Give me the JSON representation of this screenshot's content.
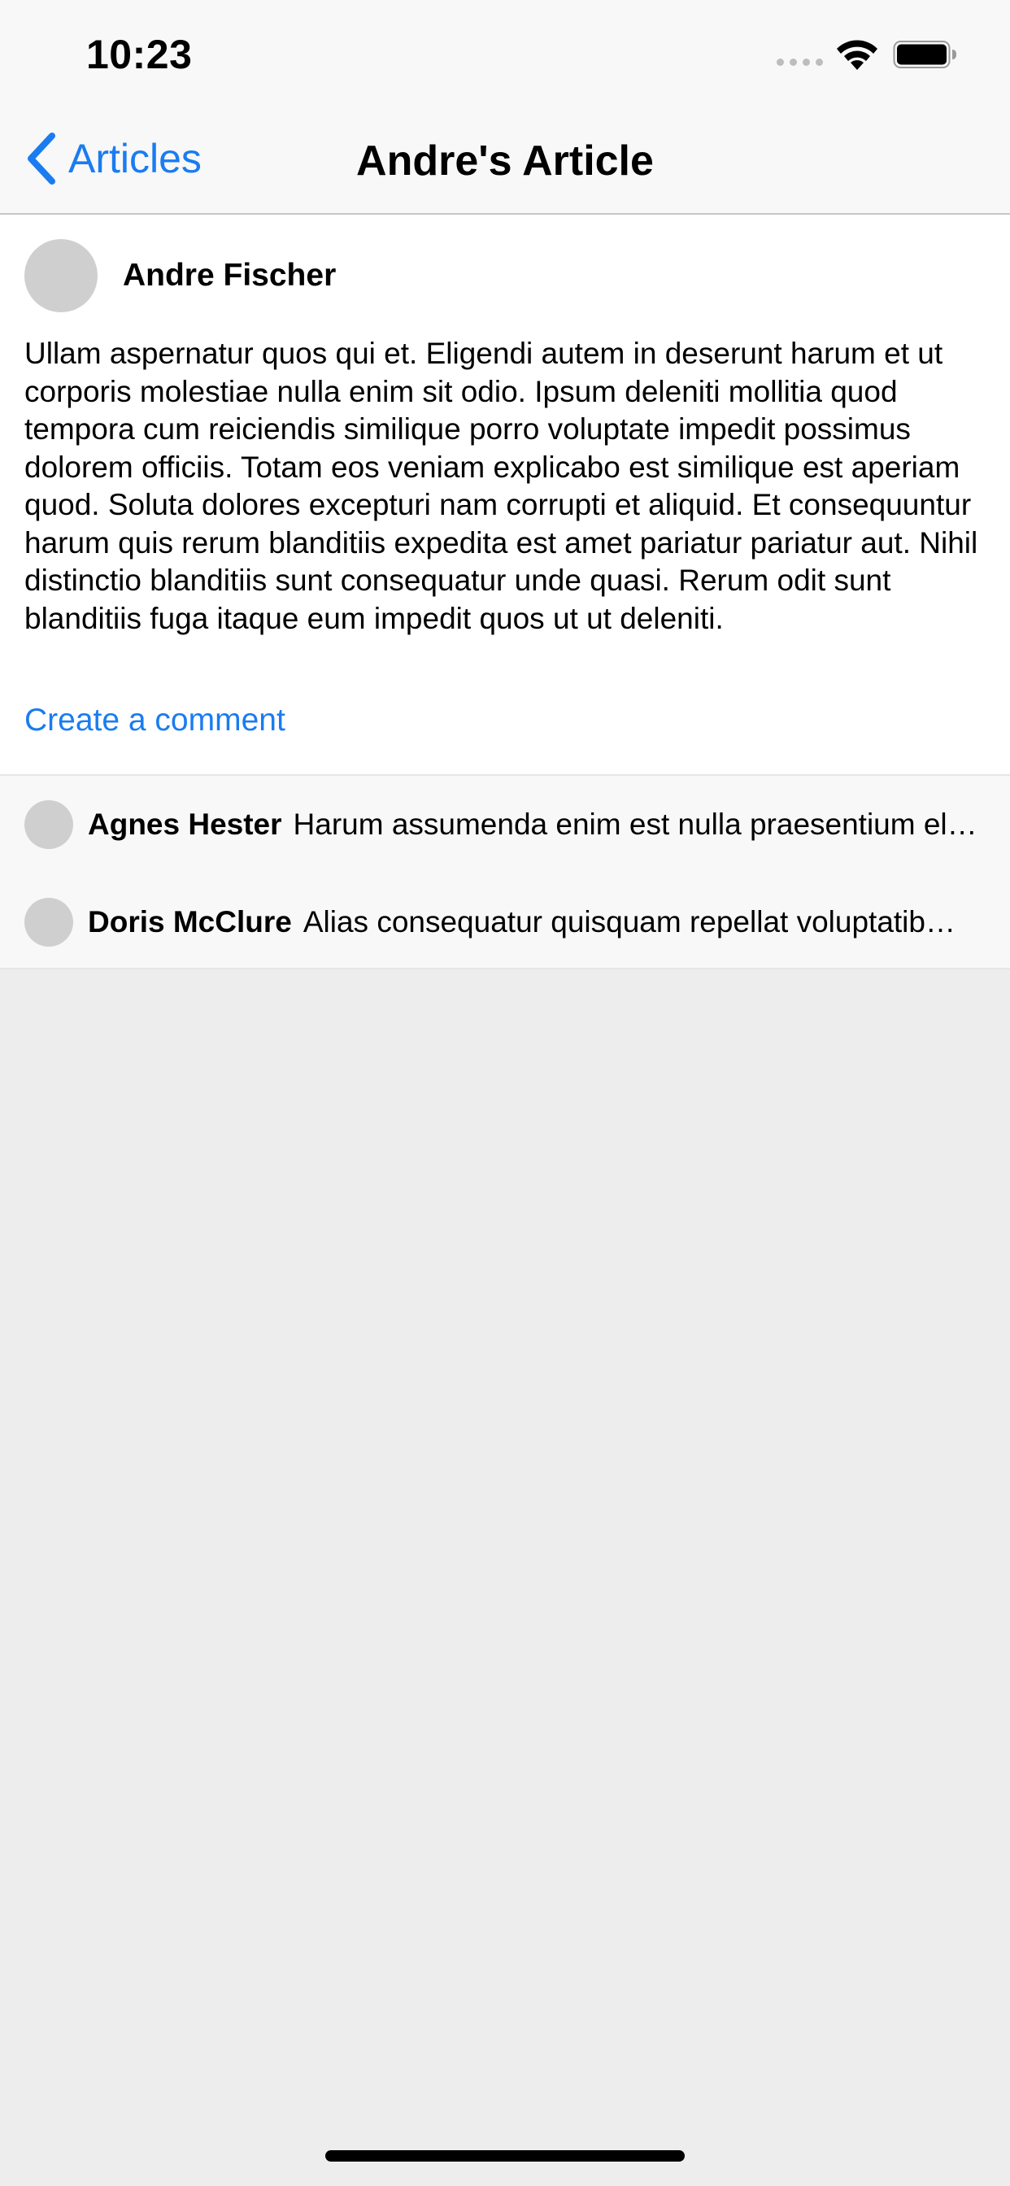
{
  "status_bar": {
    "time": "10:23"
  },
  "nav": {
    "back_label": "Articles",
    "title": "Andre's Article"
  },
  "article": {
    "author": "Andre Fischer",
    "body": "Ullam aspernatur quos qui et. Eligendi autem in deserunt harum et ut corporis molestiae nulla enim sit odio. Ipsum deleniti mollitia quod tempora cum reiciendis similique porro voluptate impedit possimus dolorem officiis. Totam eos veniam explicabo est similique est aperiam quod. Soluta dolores excepturi nam corrupti et aliquid. Et consequuntur harum quis rerum blanditiis expedita est amet pariatur pariatur aut. Nihil distinctio blanditiis sunt consequatur unde quasi. Rerum odit sunt blanditiis fuga itaque eum impedit quos ut ut deleniti.",
    "create_comment_label": "Create a comment"
  },
  "comments": [
    {
      "author": "Agnes Hester",
      "text": "Harum assumenda enim est nulla praesentium el…"
    },
    {
      "author": "Doris McClure",
      "text": "Alias consequatur quisquam repellat voluptatib…"
    }
  ],
  "colors": {
    "accent": "#1a7cf0",
    "avatar_placeholder": "#cfcfcf",
    "bar_background": "#f8f8f8",
    "page_background": "#ededed"
  },
  "icons": {
    "back": "chevron-left-icon",
    "wifi": "wifi-icon",
    "battery": "battery-icon",
    "signal": "signal-dots-icon"
  }
}
